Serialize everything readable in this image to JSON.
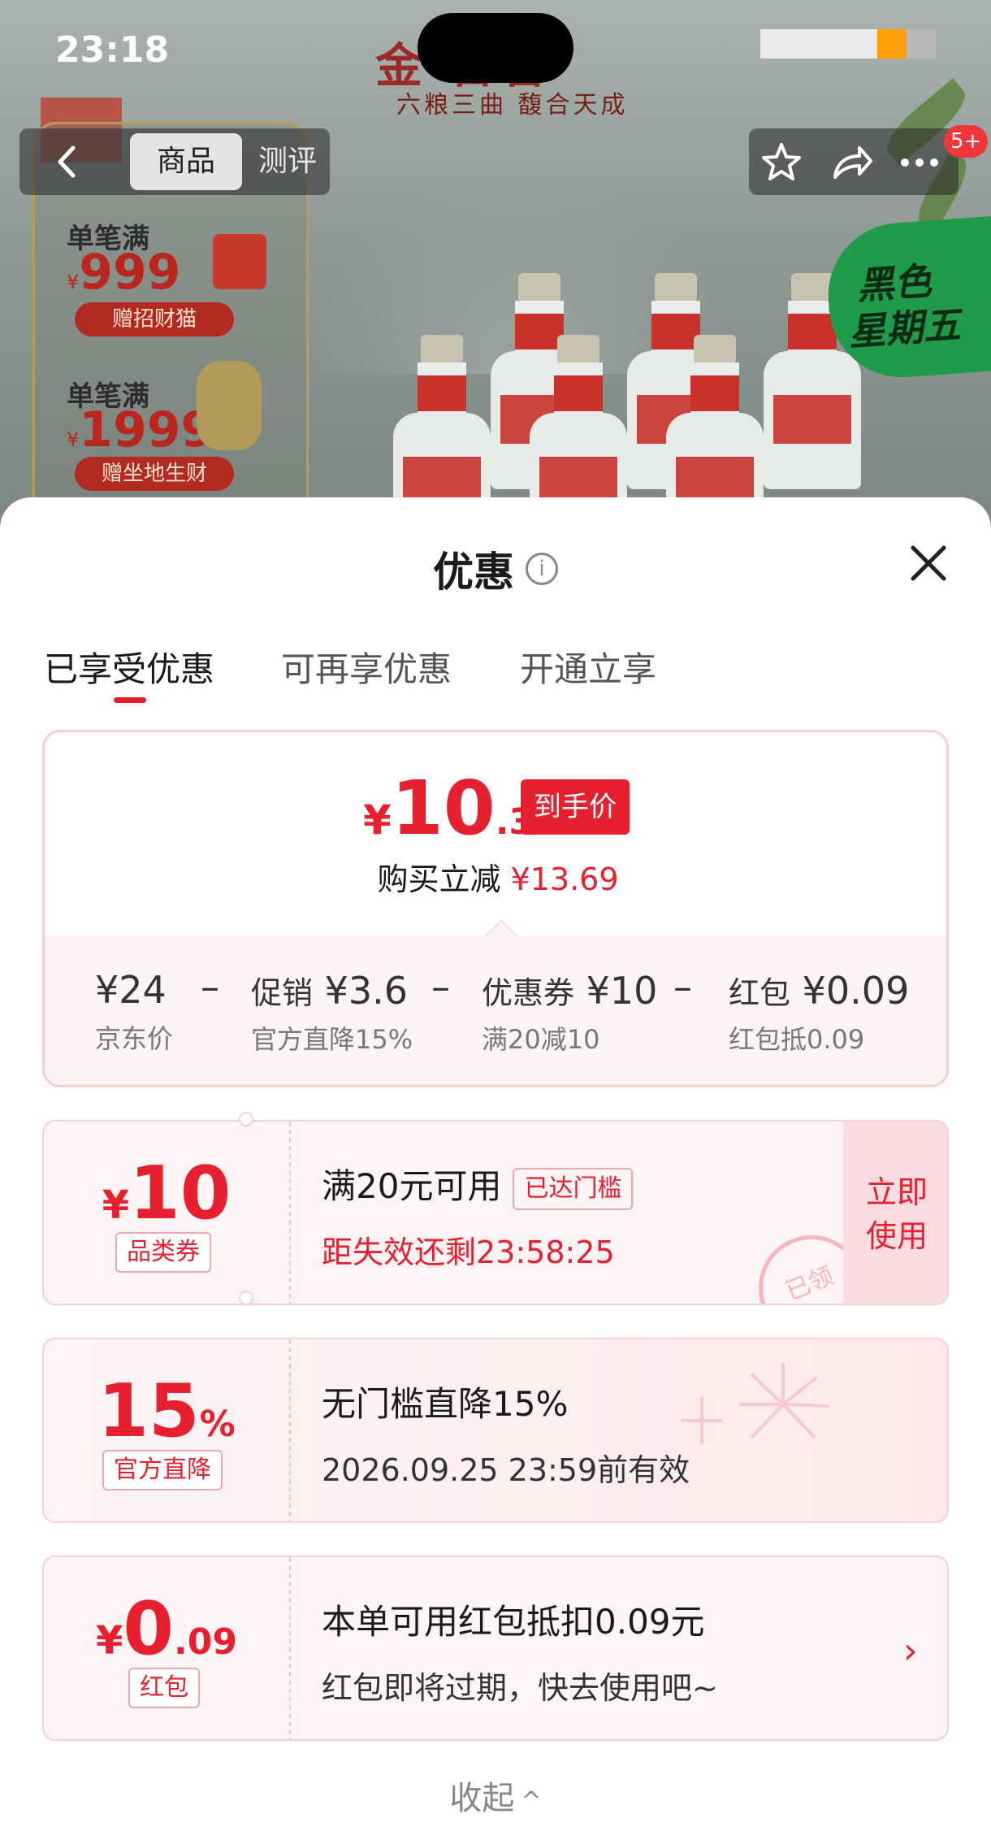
{
  "status_bar": {
    "time": "23:18"
  },
  "banner": {
    "brand_title": "金  合香",
    "brand_subtitle": "六粮三曲 馥合天成",
    "promo_1_line": "单笔满",
    "promo_1_value": "999",
    "promo_1_gift": "赠招财猫",
    "promo_2_line": "单笔满",
    "promo_2_value": "1999",
    "promo_2_gift": "赠坐地生财",
    "yen": "¥",
    "event_line1": "黑色",
    "event_line2": "星期五"
  },
  "nav": {
    "back_icon": "chevron-left-icon",
    "tabs": [
      {
        "label": "商品"
      },
      {
        "label": "测评"
      }
    ],
    "right_icons": [
      "star-icon",
      "share-icon",
      "more-icon"
    ],
    "badge": "5+"
  },
  "sheet": {
    "title": "优惠",
    "info_icon": "i",
    "tabs": [
      {
        "label": "已享受优惠"
      },
      {
        "label": "可再享优惠"
      },
      {
        "label": "开通立享"
      }
    ],
    "summary": {
      "yen": "¥",
      "price_int": "10",
      "price_dec": ".31",
      "price_tag": "到手价",
      "saved_label": "购买立减",
      "saved_amount": "¥13.69",
      "breakdown": [
        {
          "label": "",
          "amount": "¥24",
          "sub": "京东价"
        },
        {
          "label": "促销",
          "amount": "¥3.6",
          "sub": "官方直降15%"
        },
        {
          "label": "优惠券",
          "amount": "¥10",
          "sub": "满20减10"
        },
        {
          "label": "红包",
          "amount": "¥0.09",
          "sub": "红包抵0.09"
        }
      ],
      "minus": "–"
    },
    "coupons": [
      {
        "yen": "¥",
        "value": "10",
        "tag": "品类券",
        "title": "满20元可用",
        "chip": "已达门槛",
        "sub": "距失效还剩23:58:25",
        "action": "立即使用",
        "action_line1": "立即",
        "action_line2": "使用",
        "stamp": "已领"
      },
      {
        "value": "15",
        "unit": "%",
        "tag": "官方直降",
        "title": "无门槛直降15%",
        "sub": "2026.09.25 23:59前有效"
      },
      {
        "yen": "¥",
        "value": "0",
        "value_dec": ".09",
        "tag": "红包",
        "title": "本单可用红包抵扣0.09元",
        "sub": "红包即将过期，快去使用吧~",
        "chevron": "›"
      }
    ],
    "collapse_label": "收起",
    "collapse_icon": "^"
  },
  "colors": {
    "accent": "#e6202f",
    "card_border": "#f6cfd3",
    "card_bg": "#fdf4f5"
  }
}
